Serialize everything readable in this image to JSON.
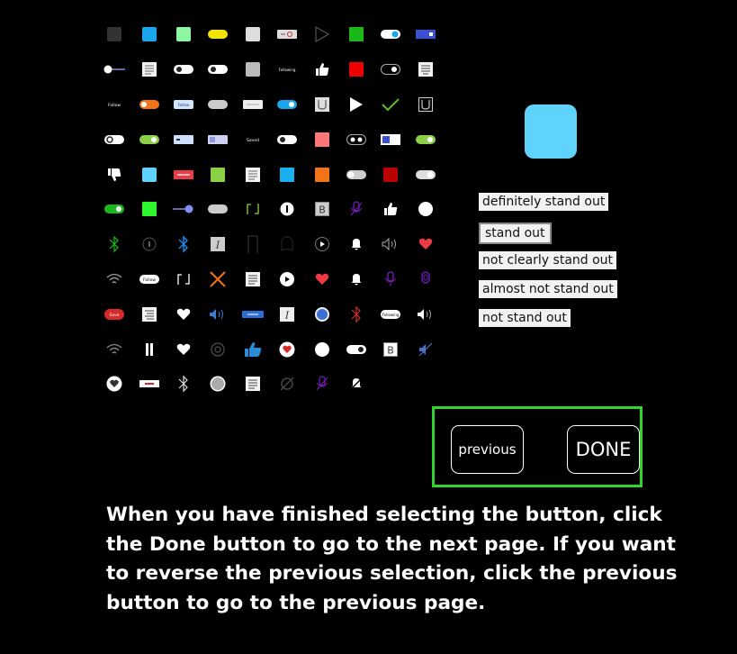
{
  "icon_grid": [
    "dark-square-icon",
    "blue-square-icon",
    "mint-square-icon",
    "yellow-pill-icon",
    "white-square-icon",
    "record-toggle-icon",
    "play-outline-icon",
    "green-square-icon",
    "blue-toggle-icon",
    "blue-indicator-icon",
    "slider-icon",
    "document-icon",
    "toggle-off-icon",
    "toggle-off-icon",
    "gray-square-icon",
    "follow-button-icon",
    "thumbs-up-icon",
    "red-square-icon",
    "toggle-dark-icon",
    "lines-icon",
    "follow-small-icon",
    "orange-toggle-icon",
    "follow-pill-icon",
    "gray-pill-icon",
    "white-pill-icon",
    "blue-toggle-icon",
    "trash-icon",
    "play-icon",
    "check-icon",
    "trash-outline-icon",
    "toggle-ring-icon",
    "green-toggle-icon",
    "minus-badge-icon",
    "lilac-pill-icon",
    "saved-label-icon",
    "toggle-off-icon",
    "salmon-square-icon",
    "radio-toggle-icon",
    "flag-toggle-icon",
    "green-toggle-icon",
    "thumbs-down-icon",
    "cyan-square-icon",
    "red-slider-icon",
    "lime-square-icon",
    "document-icon",
    "cyan-square-icon",
    "orange-square-icon",
    "white-toggle-icon",
    "dark-red-square-icon",
    "gray-toggle-icon",
    "green-toggle-icon",
    "bright-green-square-icon",
    "blue-slider-icon",
    "gray-pill-icon",
    "repeat-icon",
    "exclamation-icon",
    "bold-b-icon",
    "mic-off-icon",
    "thumbs-up-icon",
    "white-circle-icon",
    "bluetooth-icon",
    "info-icon",
    "bluetooth-icon",
    "italic-i-icon",
    "bracket-icon",
    "ghost-icon",
    "play-circle-icon",
    "bell-icon",
    "volume-icon",
    "heart-icon",
    "wifi-icon",
    "follow-pill-icon",
    "repeat-icon",
    "close-icon",
    "document-icon",
    "play-circle-icon",
    "heart-icon",
    "bell-icon",
    "mic-icon",
    "mic-outline-icon",
    "save-pill-icon",
    "lines-icon",
    "heart-icon",
    "volume-icon",
    "blue-bar-icon",
    "italic-i-icon",
    "blue-circle-icon",
    "bluetooth-icon",
    "following-pill-icon",
    "volume-icon",
    "wifi-icon",
    "pause-icon",
    "heart-icon",
    "eye-icon",
    "thumbs-up-icon",
    "heart-circle-icon",
    "white-circle-icon",
    "toggle-icon",
    "bold-b-icon",
    "volume-off-icon",
    "heart-circle-icon",
    "red-line-icon",
    "bluetooth-icon",
    "gray-circle-icon",
    "document-icon",
    "eye-off-icon",
    "mic-off-icon",
    "bell-off-icon"
  ],
  "grid_labels": {
    "follow": "Follow",
    "saved": "Saved",
    "follow_small": "Follow",
    "follow_pill": "Follow",
    "save": "Save",
    "following": "Following"
  },
  "options": {
    "definitely": "definitely stand out",
    "stand_out": "stand out",
    "not_clearly": "not clearly stand out",
    "almost_not": "almost not stand out",
    "not_stand": "not stand out"
  },
  "preview_color": "#5fd3fb",
  "buttons": {
    "previous": "previous",
    "done": "DONE"
  },
  "instructions": "When you have finished selecting the button, click the Done button to go to the next page. If you want to reverse the previous selection, click the previous button to go to the previous page.",
  "colors": {
    "nav_border": "#2ed52e",
    "background": "#000000"
  }
}
